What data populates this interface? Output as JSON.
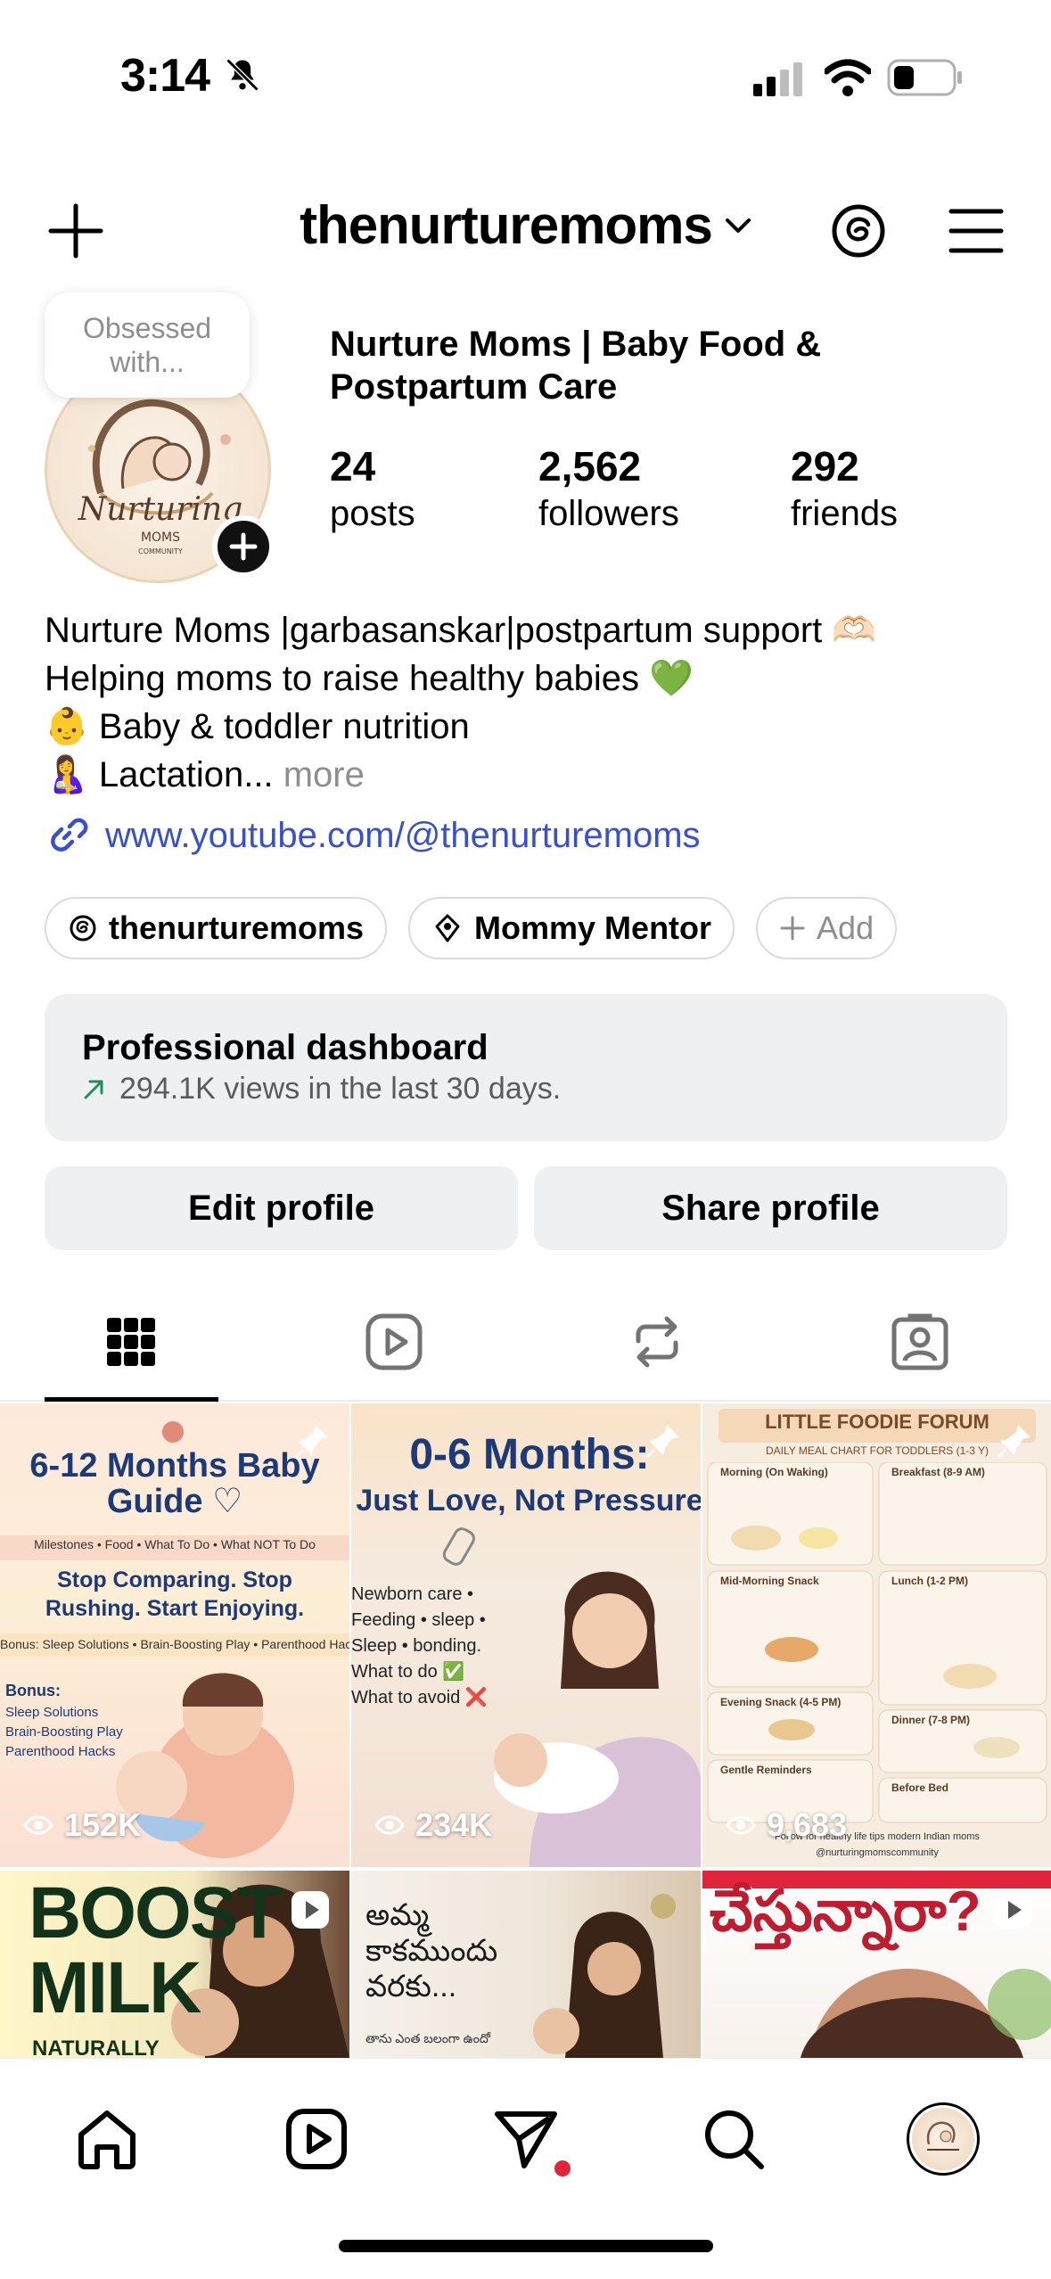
{
  "status_bar": {
    "time": "3:14"
  },
  "header": {
    "username": "thenurturemoms"
  },
  "profile": {
    "note": "Obsessed with...",
    "display_name": "Nurture Moms | Baby Food & Postpartum Care",
    "stats": [
      {
        "number": "24",
        "label": "posts"
      },
      {
        "number": "2,562",
        "label": "followers"
      },
      {
        "number": "292",
        "label": "friends"
      }
    ],
    "bio_lines": [
      "Nurture Moms |garbasanskar|postpartum support 🫶🏻",
      "Helping moms to raise healthy babies 💚",
      "👶 Baby & toddler nutrition",
      "🤱 Lactation..."
    ],
    "bio_more": "more",
    "link": "www.youtube.com/@thenurturemoms",
    "chips": [
      {
        "label": "thenurturemoms",
        "icon": "threads-icon"
      },
      {
        "label": "Mommy Mentor",
        "icon": "badge-icon"
      },
      {
        "label": "Add",
        "icon": "plus-icon"
      }
    ],
    "dashboard": {
      "title": "Professional dashboard",
      "subtitle": "294.1K views in the last 30 days."
    },
    "buttons": {
      "edit": "Edit profile",
      "share": "Share profile"
    }
  },
  "tabs": [
    {
      "name": "grid",
      "icon": "grid-icon",
      "active": true
    },
    {
      "name": "reels",
      "icon": "reels-icon",
      "active": false
    },
    {
      "name": "reposts",
      "icon": "repost-icon",
      "active": false
    },
    {
      "name": "tagged",
      "icon": "tagged-icon",
      "active": false
    }
  ],
  "posts": [
    {
      "title": "6-12 Months Baby Guide ♡",
      "tags": "Milestones • Food • What To Do • What NOT To Do",
      "headline": "Stop Comparing. Stop Rushing. Start Enjoying.",
      "bonus_bar": "Bonus: Sleep Solutions • Brain-Boosting Play • Parenthood Hacks",
      "bonus_title": "Bonus:",
      "bonus_items": [
        "Sleep Solutions",
        "Brain-Boosting Play",
        "Parenthood Hacks"
      ],
      "views": "152K",
      "pinned": true
    },
    {
      "title": "0-6 Months:",
      "subtitle": "Just Love, Not Pressure",
      "items": [
        "Newborn care •",
        "Feeding • sleep •",
        "Sleep • bonding.",
        "What to do ✅",
        "What to avoid ❌"
      ],
      "views": "234K",
      "pinned": true
    },
    {
      "title": "LITTLE FOODIE FORUM",
      "subtitle": "DAILY MEAL CHART FOR TODDLERS (1-3 Y)",
      "sections": [
        "Morning (On Waking)",
        "Breakfast (8-9 AM)",
        "Mid-Morning Snack",
        "Lunch (1-2 PM)",
        "Evening Snack (4-5 PM)",
        "Dinner (7-8 PM)",
        "Gentle Reminders",
        "Before Bed"
      ],
      "footer": "Follow for healthy life tips modern Indian moms",
      "handle": "@nurturingmomscommunity",
      "views": "9,683",
      "pinned": true
    },
    {
      "title": "BOOST MILK",
      "subtitle": "NATURALLY",
      "type": "reel"
    },
    {
      "title": "అమ్మ కాకముందు వరకు...",
      "subtitle": "తాను ఎంత బలంగా ఉందో",
      "type": "reel"
    },
    {
      "title": "చేస్తున్నారా?",
      "type": "reel"
    }
  ],
  "colors": {
    "link": "#3750d2",
    "button_bg": "#eff0f2",
    "notification_dot": "#e0243a"
  }
}
